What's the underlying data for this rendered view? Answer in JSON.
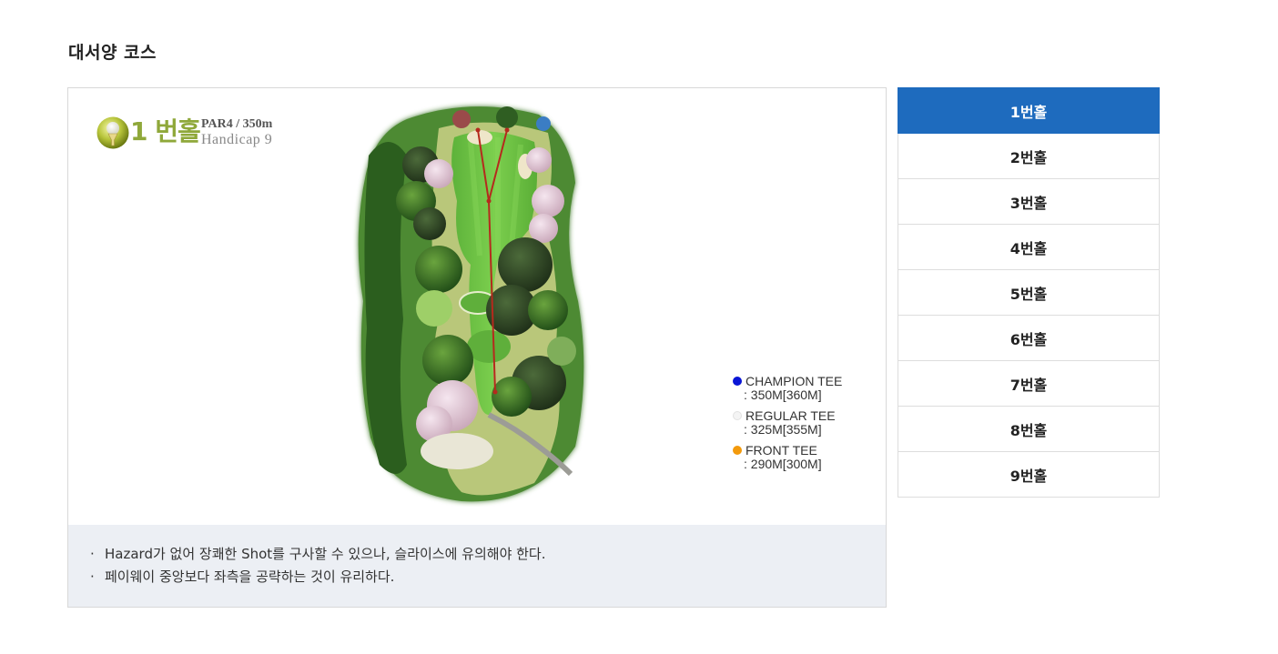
{
  "page": {
    "title": "대서양 코스"
  },
  "hole": {
    "number": "1",
    "label": "번홀",
    "par_line": "PAR4 / 350m",
    "handicap_line": "Handicap  9",
    "ball_icon": "golf-ball-on-tee-icon"
  },
  "tees": [
    {
      "name": "CHAMPION TEE",
      "distance": ": 350M[360M]",
      "color": "#0a16d6"
    },
    {
      "name": "REGULAR TEE",
      "distance": ": 325M[355M]",
      "color": "#f4f4f4"
    },
    {
      "name": "FRONT TEE",
      "distance": ": 290M[300M]",
      "color": "#f39a0c"
    }
  ],
  "description": {
    "bullet": "·",
    "lines": [
      "Hazard가 없어 장쾌한 Shot를 구사할 수 있으나, 슬라이스에 유의해야 한다.",
      "페이웨이 중앙보다 좌측을 공략하는 것이 유리하다."
    ]
  },
  "hole_tabs": {
    "active_index": 0,
    "items": [
      "1번홀",
      "2번홀",
      "3번홀",
      "4번홀",
      "5번홀",
      "6번홀",
      "7번홀",
      "8번홀",
      "9번홀"
    ]
  },
  "colors": {
    "accent": "#1e6bbe",
    "desc_bg": "#eceff4",
    "hole_label": "#8fa83a"
  }
}
